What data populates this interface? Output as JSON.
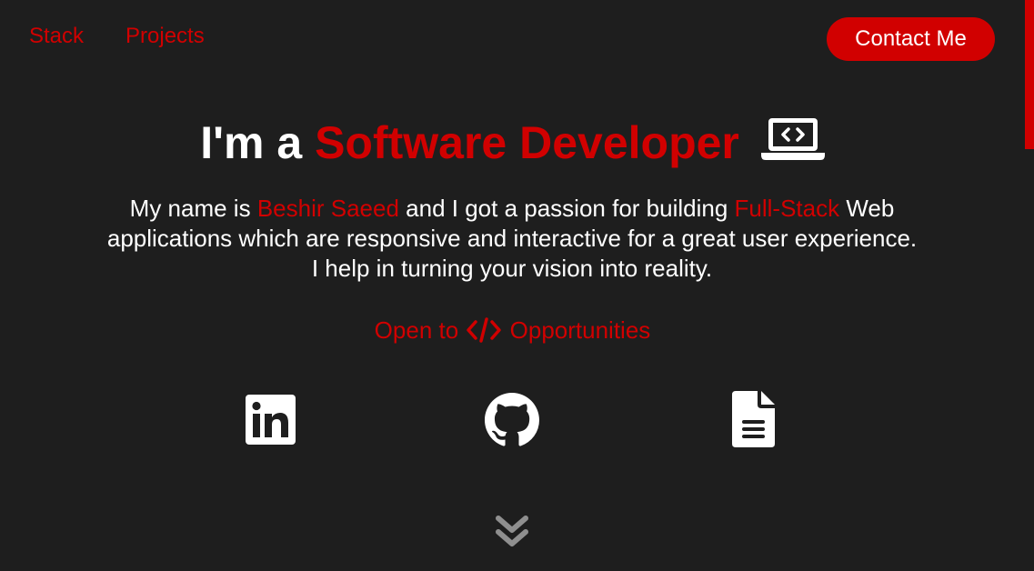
{
  "nav": {
    "items": [
      {
        "label": "Stack"
      },
      {
        "label": "Projects"
      }
    ]
  },
  "contact_button": {
    "label": "Contact Me"
  },
  "hero": {
    "title_prefix": "I'm a",
    "title_highlight": "Software Developer",
    "title_icon": "laptop-code-icon",
    "intro_prefix": "My name is",
    "intro_name": "Beshir Saeed",
    "intro_mid": "and I got a passion for building",
    "intro_highlight": "Full-Stack",
    "intro_rest": "Web applications which are responsive and interactive for a great user experience. I help in turning your vision into reality.",
    "open_prefix": "Open to",
    "open_icon": "code-icon",
    "open_suffix": "Opportunities"
  },
  "social": [
    {
      "icon": "linkedin-icon"
    },
    {
      "icon": "github-icon"
    },
    {
      "icon": "resume-file-icon"
    }
  ],
  "scroll_icon": "double-chevron-down-icon",
  "colors": {
    "background": "#1e1e1e",
    "accent": "#d10000",
    "text": "#ffffff",
    "muted": "#8f8f8f"
  }
}
